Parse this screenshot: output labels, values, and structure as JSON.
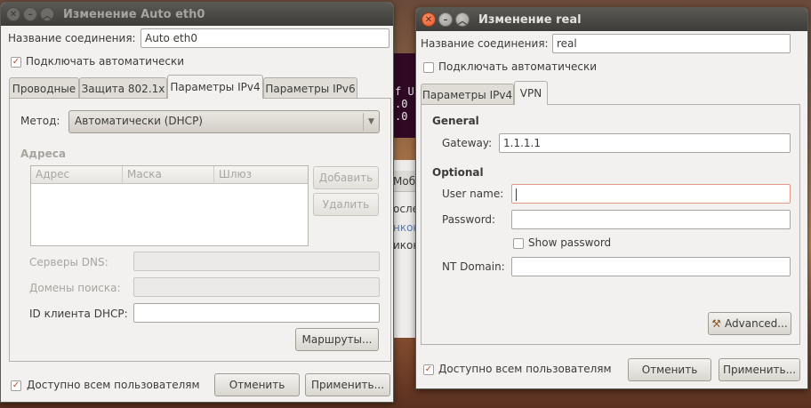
{
  "background": {
    "terminal_lines": [
      "f Us",
      ".0",
      ".0"
    ],
    "window_lines": [
      "Моб",
      "осле",
      "нкон",
      "икон"
    ]
  },
  "left_window": {
    "title": "Изменение Auto eth0",
    "connection_name_label": "Название соединения:",
    "connection_name_value": "Auto eth0",
    "autoconnect_label": "Подключать автоматически",
    "autoconnect_checked": true,
    "tabs": [
      "Проводные",
      "Защита 802.1x",
      "Параметры IPv4",
      "Параметры IPv6"
    ],
    "active_tab": "Параметры IPv4",
    "method_label": "Метод:",
    "method_value": "Автоматически (DHCP)",
    "addresses_label": "Адреса",
    "columns": [
      "Адрес",
      "Маска",
      "Шлюз"
    ],
    "add_button": "Добавить",
    "delete_button": "Удалить",
    "dns_label": "Серверы DNS:",
    "search_domains_label": "Домены поиска:",
    "dhcp_id_label": "ID клиента DHCP:",
    "routes_button": "Маршруты...",
    "all_users_label": "Доступно всем пользователям",
    "all_users_checked": true,
    "cancel_button": "Отменить",
    "apply_button": "Применить..."
  },
  "right_window": {
    "title": "Изменение real",
    "connection_name_label": "Название соединения:",
    "connection_name_value": "real",
    "autoconnect_label": "Подключать автоматически",
    "autoconnect_checked": false,
    "tabs": [
      "Параметры IPv4",
      "VPN"
    ],
    "active_tab": "VPN",
    "general_heading": "General",
    "gateway_label": "Gateway:",
    "gateway_value": "1.1.1.1",
    "optional_heading": "Optional",
    "username_label": "User name:",
    "password_label": "Password:",
    "show_password_label": "Show password",
    "ntdomain_label": "NT Domain:",
    "advanced_button": "Advanced...",
    "all_users_label": "Доступно всем пользователям",
    "all_users_checked": true,
    "cancel_button": "Отменить",
    "apply_button": "Применить..."
  },
  "colors": {
    "accent": "#e45a2a",
    "check": "#d0422a",
    "terminal": "#300a24"
  }
}
